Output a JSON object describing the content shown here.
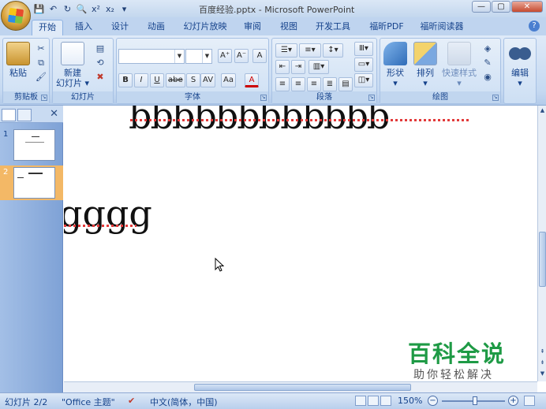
{
  "titlebar": {
    "title": "百度经验.pptx - Microsoft PowerPoint",
    "qat_icons": [
      "save-icon",
      "undo-icon",
      "redo-icon",
      "print-preview-icon",
      "superscript-icon",
      "subscript-icon",
      "customize-qat-icon"
    ],
    "qat_glyphs": [
      "💾",
      "↶",
      "↻",
      "🔍",
      "x²",
      "x₂",
      "▾"
    ],
    "window_buttons": {
      "minimize": "—",
      "maximize": "▢",
      "close": "✕"
    }
  },
  "tabs": [
    "开始",
    "插入",
    "设计",
    "动画",
    "幻灯片放映",
    "审阅",
    "视图",
    "开发工具",
    "福昕PDF",
    "福昕阅读器"
  ],
  "active_tab": 0,
  "ribbon": {
    "clipboard": {
      "label": "剪贴板",
      "paste": "粘贴"
    },
    "slides": {
      "label": "幻灯片",
      "new_slide_line1": "新建",
      "new_slide_line2": "幻灯片 ▾"
    },
    "font": {
      "label": "字体",
      "font_name": "",
      "font_size": "",
      "grow": "A⁺",
      "shrink": "A⁻",
      "clear": "A",
      "bold": "B",
      "italic": "I",
      "underline": "U",
      "strike": "abe",
      "shadow": "S",
      "spacing": "AV",
      "case": "Aa",
      "color": "A"
    },
    "paragraph": {
      "label": "段落"
    },
    "drawing": {
      "label": "绘图",
      "shapes": "形状",
      "arrange": "排列",
      "quick_styles": "快速样式"
    },
    "editing": {
      "label": "编辑",
      "edit": "编辑"
    }
  },
  "left_panel": {
    "slides": [
      {
        "number": "1",
        "selected": false
      },
      {
        "number": "2",
        "selected": true
      }
    ],
    "close": "✕"
  },
  "slide": {
    "line1": "bbbbbbbbbbbb",
    "line2": "gggg"
  },
  "watermark": {
    "title": "百科全说",
    "subtitle": "助你轻松解决"
  },
  "statusbar": {
    "slide_info": "幻灯片 2/2",
    "theme": "\"Office 主题\"",
    "language": "中文(简体，中国)",
    "zoom": "150%",
    "zoom_minus": "−",
    "zoom_plus": "+"
  }
}
